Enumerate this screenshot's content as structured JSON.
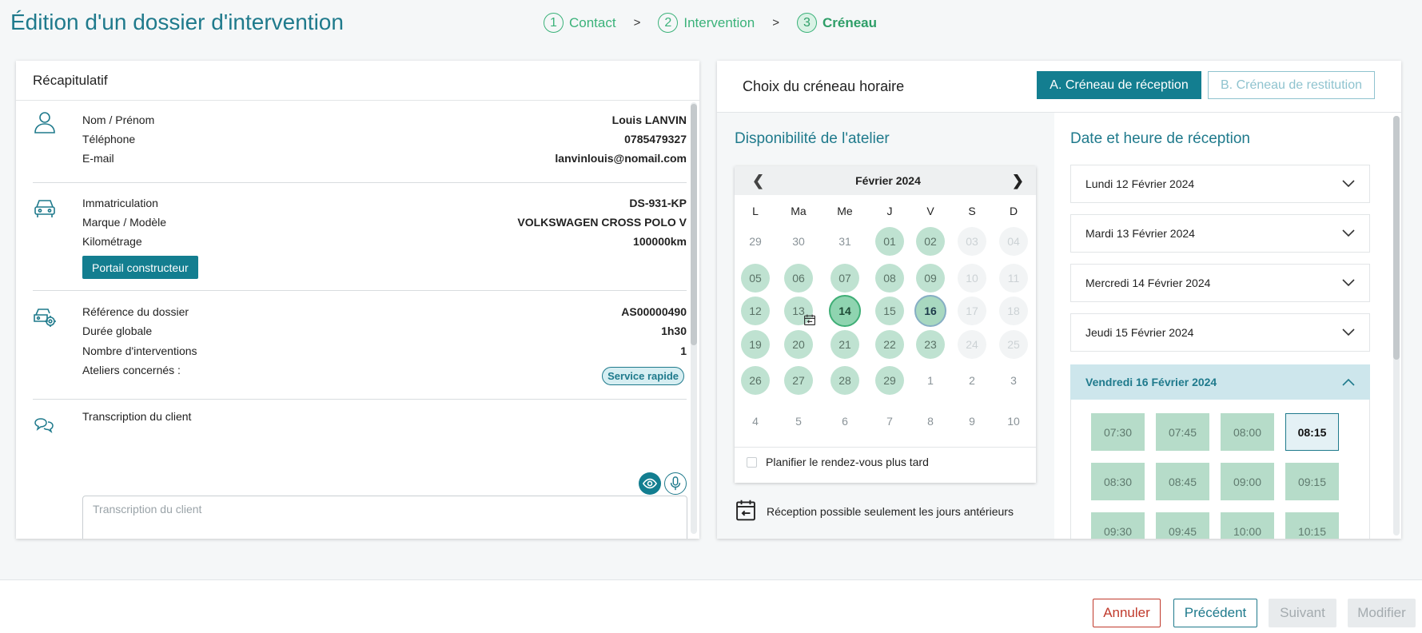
{
  "page_title": "Édition d'un dossier d'intervention",
  "stepper": [
    {
      "num": "1",
      "label": "Contact"
    },
    {
      "num": "2",
      "label": "Intervention"
    },
    {
      "num": "3",
      "label": "Créneau"
    }
  ],
  "stepper_sep": ">",
  "summary": {
    "title": "Récapitulatif",
    "contact": {
      "name_label": "Nom / Prénom",
      "name_value": "Louis LANVIN",
      "phone_label": "Téléphone",
      "phone_value": "0785479327",
      "email_label": "E-mail",
      "email_value": "lanvinlouis@nomail.com"
    },
    "vehicle": {
      "plate_label": "Immatriculation",
      "plate_value": "DS-931-KP",
      "model_label": "Marque / Modèle",
      "model_value": "VOLKSWAGEN CROSS POLO V",
      "km_label": "Kilométrage",
      "km_value": "100000km",
      "portal_button": "Portail constructeur"
    },
    "file": {
      "ref_label": "Référence du dossier",
      "ref_value": "AS00000490",
      "duration_label": "Durée globale",
      "duration_value": "1h30",
      "count_label": "Nombre d'interventions",
      "count_value": "1",
      "workshops_label": "Ateliers concernés :",
      "workshops_value": "Service rapide"
    },
    "transcription": {
      "label": "Transcription du client",
      "placeholder": "Transcription du client"
    }
  },
  "slot_panel": {
    "title": "Choix du créneau horaire",
    "tab_reception": "A. Créneau de réception",
    "tab_return": "B. Créneau de restitution",
    "availability_title": "Disponibilité de l'atelier",
    "datetime_title": "Date et heure de réception",
    "calendar": {
      "month": "Février 2024",
      "prev": "❮",
      "next": "❯",
      "dow": [
        "L",
        "Ma",
        "Me",
        "J",
        "V",
        "S",
        "D"
      ],
      "weeks": [
        [
          "29",
          "30",
          "31",
          "01",
          "02",
          "03",
          "04"
        ],
        [
          "05",
          "06",
          "07",
          "08",
          "09",
          "10",
          "11"
        ],
        [
          "12",
          "13",
          "14",
          "15",
          "16",
          "17",
          "18"
        ],
        [
          "19",
          "20",
          "21",
          "22",
          "23",
          "24",
          "25"
        ],
        [
          "26",
          "27",
          "28",
          "29",
          "1",
          "2",
          "3"
        ],
        [
          "4",
          "5",
          "6",
          "7",
          "8",
          "9",
          "10"
        ]
      ],
      "plan_later": "Planifier le rendez-vous plus tard"
    },
    "legend_text": "Réception possible seulement les jours antérieurs",
    "days": [
      {
        "label": "Lundi 12 Février 2024"
      },
      {
        "label": "Mardi 13 Février 2024"
      },
      {
        "label": "Mercredi 14 Février 2024"
      },
      {
        "label": "Jeudi 15 Février 2024"
      },
      {
        "label": "Vendredi 16 Février 2024"
      }
    ],
    "slots": [
      "07:30",
      "07:45",
      "08:00",
      "08:15",
      "08:30",
      "08:45",
      "09:00",
      "09:15",
      "09:30",
      "09:45",
      "10:00",
      "10:15"
    ],
    "selected_slot": "08:15"
  },
  "footer": {
    "cancel": "Annuler",
    "previous": "Précédent",
    "next": "Suivant",
    "modify": "Modifier"
  },
  "colors": {
    "primary": "#137e90",
    "success": "#3bb27a",
    "danger": "#c0392b"
  }
}
